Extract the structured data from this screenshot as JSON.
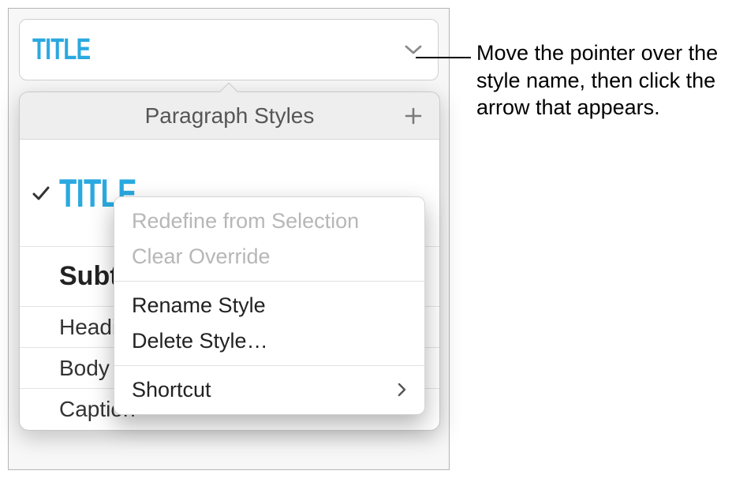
{
  "selector": {
    "title_label": "TITLE"
  },
  "popover": {
    "header": "Paragraph Styles",
    "styles": {
      "title": "TITLE",
      "subtitle": "Subtitle",
      "heading": "Heading",
      "body": "Body",
      "caption": "Caption"
    }
  },
  "context_menu": {
    "redefine": "Redefine from Selection",
    "clear": "Clear Override",
    "rename": "Rename Style",
    "delete": "Delete Style…",
    "shortcut": "Shortcut"
  },
  "callout": {
    "text": "Move the pointer over the style name, then click the arrow that appears."
  }
}
